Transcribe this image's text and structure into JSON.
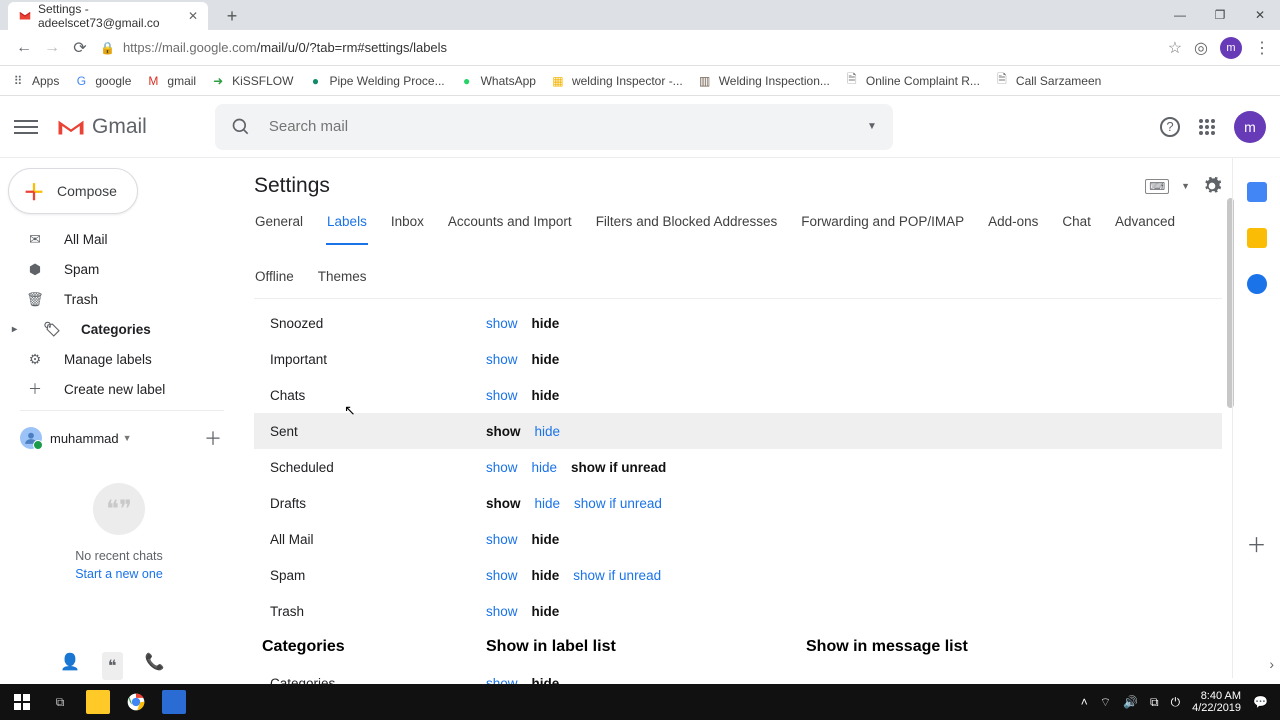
{
  "browser": {
    "tab_title": "Settings - adeelscet73@gmail.co",
    "url_scheme_host": "https://mail.google.com",
    "url_path": "/mail/u/0/?tab=rm#settings/labels",
    "avatar_letter": "m"
  },
  "window_controls": {
    "min": "—",
    "max": "❐",
    "close": "✕"
  },
  "bookmarks": [
    {
      "label": "Apps",
      "icon": "⠿",
      "color": "#5f6368"
    },
    {
      "label": "google",
      "icon": "G",
      "color": "#4285f4"
    },
    {
      "label": "gmail",
      "icon": "M",
      "color": "#d93025"
    },
    {
      "label": "KiSSFLOW",
      "icon": "➜",
      "color": "#2e9e43"
    },
    {
      "label": "Pipe Welding Proce...",
      "icon": "●",
      "color": "#148a6b"
    },
    {
      "label": "WhatsApp",
      "icon": "●",
      "color": "#25d366"
    },
    {
      "label": "welding Inspector -...",
      "icon": "▦",
      "color": "#f3b400"
    },
    {
      "label": "Welding Inspection...",
      "icon": "▥",
      "color": "#6b5a4a"
    },
    {
      "label": "Online Complaint R...",
      "icon": "🗎",
      "color": "#777"
    },
    {
      "label": "Call Sarzameen",
      "icon": "🗎",
      "color": "#777"
    }
  ],
  "gmail": {
    "product": "Gmail",
    "search_placeholder": "Search mail",
    "compose": "Compose",
    "avatar_letter": "m"
  },
  "sidebar": {
    "items": [
      {
        "icon": "✉",
        "label": "All Mail",
        "bold": false
      },
      {
        "icon": "⬢",
        "label": "Spam",
        "bold": false
      },
      {
        "icon": "🗑",
        "label": "Trash",
        "bold": false
      },
      {
        "icon": "🏷",
        "label": "Categories",
        "bold": true,
        "cat": true
      },
      {
        "icon": "⚙",
        "label": "Manage labels",
        "bold": false
      },
      {
        "icon": "＋",
        "label": "Create new label",
        "bold": false
      }
    ],
    "user": "muhammad",
    "no_chats": "No recent chats",
    "start_new": "Start a new one"
  },
  "settings": {
    "title": "Settings",
    "tabs": [
      "General",
      "Labels",
      "Inbox",
      "Accounts and Import",
      "Filters and Blocked Addresses",
      "Forwarding and POP/IMAP",
      "Add-ons",
      "Chat",
      "Advanced",
      "Offline",
      "Themes"
    ],
    "active_tab": "Labels",
    "rows": [
      {
        "name": "Snoozed",
        "show": "link",
        "hide": "strong"
      },
      {
        "name": "Important",
        "show": "link",
        "hide": "strong"
      },
      {
        "name": "Chats",
        "show": "link",
        "hide": "strong"
      },
      {
        "name": "Sent",
        "show": "strong",
        "hide": "link",
        "hover": true
      },
      {
        "name": "Scheduled",
        "show": "link",
        "hide": "link",
        "extra": "show if unread",
        "extra_style": "strong"
      },
      {
        "name": "Drafts",
        "show": "strong",
        "hide": "link",
        "extra": "show if unread",
        "extra_style": "link"
      },
      {
        "name": "All Mail",
        "show": "link",
        "hide": "strong"
      },
      {
        "name": "Spam",
        "show": "link",
        "hide": "strong",
        "extra": "show if unread",
        "extra_style": "link"
      },
      {
        "name": "Trash",
        "show": "link",
        "hide": "strong"
      }
    ],
    "section": {
      "name": "Categories",
      "col2": "Show in label list",
      "col3": "Show in message list"
    },
    "rows2": [
      {
        "name": "Categories",
        "show": "link",
        "hide": "strong"
      }
    ],
    "lbl_show": "show",
    "lbl_hide": "hide"
  },
  "taskbar": {
    "time": "8:40 AM",
    "date": "4/22/2019"
  }
}
